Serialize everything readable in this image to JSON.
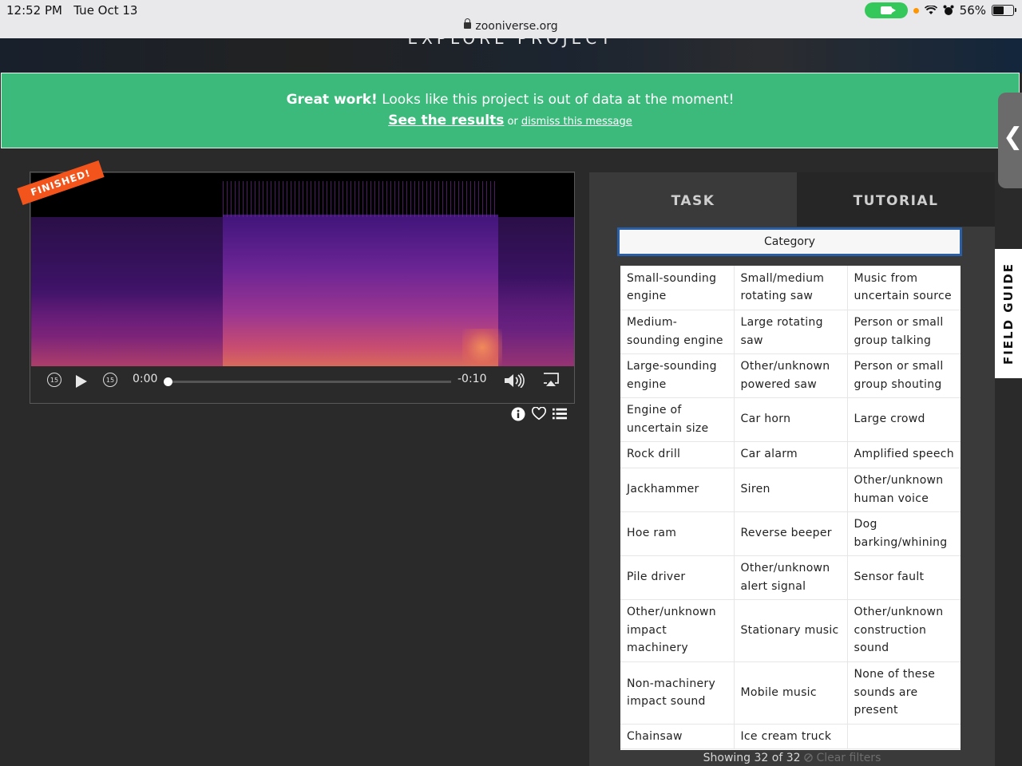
{
  "status_bar": {
    "time": "12:52 PM",
    "date": "Tue Oct 13",
    "url": "zooniverse.org",
    "battery": "56%"
  },
  "hero": {
    "title": "EXPLORE PROJECT"
  },
  "banner": {
    "bold": "Great work!",
    "message": " Looks like this project is out of data at the moment!",
    "results_link": "See the results",
    "or": " or ",
    "dismiss_link": "dismiss this message"
  },
  "player": {
    "badge": "FINISHED!",
    "current_time": "0:00",
    "remaining_time": "-0:10",
    "skip_back": "15",
    "skip_fwd": "15",
    "progress": 0
  },
  "panel": {
    "tab_task": "TASK",
    "tab_tutorial": "TUTORIAL",
    "category_label": "Category",
    "choices": [
      [
        "Small-sounding engine",
        "Small/medium rotating saw",
        "Music from uncertain source"
      ],
      [
        "Medium-sounding engine",
        "Large rotating saw",
        "Person or small group talking"
      ],
      [
        "Large-sounding engine",
        "Other/unknown powered saw",
        "Person or small group shouting"
      ],
      [
        "Engine of uncertain size",
        "Car horn",
        "Large crowd"
      ],
      [
        "Rock drill",
        "Car alarm",
        "Amplified speech"
      ],
      [
        "Jackhammer",
        "Siren",
        "Other/unknown human voice"
      ],
      [
        "Hoe ram",
        "Reverse beeper",
        "Dog barking/whining"
      ],
      [
        "Pile driver",
        "Other/unknown alert signal",
        "Sensor fault"
      ],
      [
        "Other/unknown impact machinery",
        "Stationary music",
        "Other/unknown construction sound"
      ],
      [
        "Non-machinery impact sound",
        "Mobile music",
        "None of these sounds are present"
      ],
      [
        "Chainsaw",
        "Ice cream truck",
        ""
      ]
    ],
    "showing": "Showing 32 of 32",
    "clear_filters": "Clear filters"
  },
  "side": {
    "field_guide": "FIELD GUIDE",
    "collapse": "❮"
  },
  "colors": {
    "banner": "#3cba7c",
    "badge": "#f2541b",
    "category_border": "#2a5fa8"
  }
}
